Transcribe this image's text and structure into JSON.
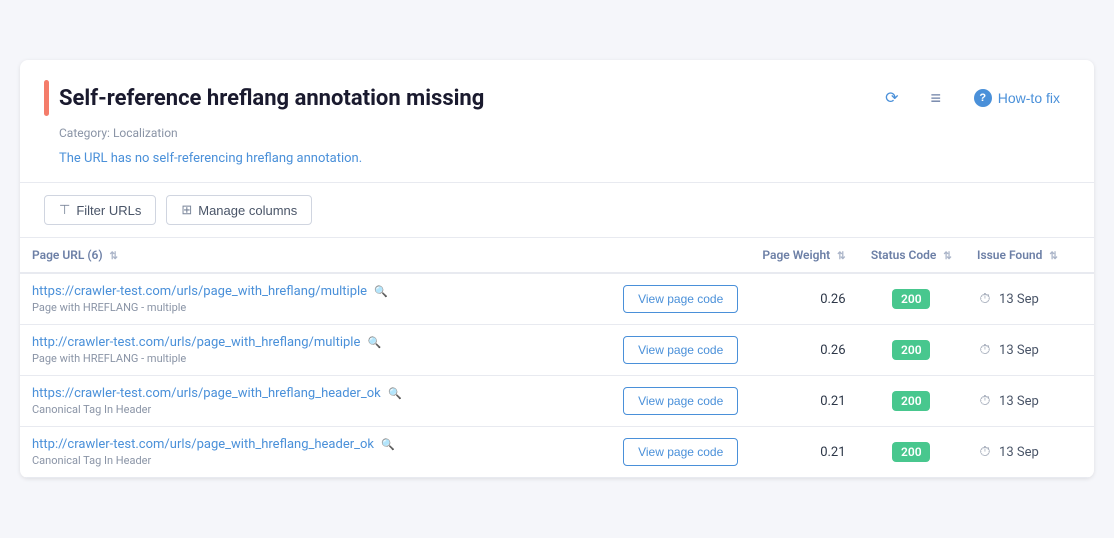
{
  "header": {
    "title": "Self-reference hreflang annotation missing",
    "category_label": "Category: Localization",
    "description": "The URL has no self-referencing hreflang annotation.",
    "how_to_fix_label": "How-to fix"
  },
  "toolbar": {
    "filter_label": "Filter URLs",
    "manage_label": "Manage columns"
  },
  "table": {
    "columns": [
      {
        "label": "Page URL (6)",
        "key": "url"
      },
      {
        "label": "",
        "key": "view"
      },
      {
        "label": "Page Weight",
        "key": "weight"
      },
      {
        "label": "Status Code",
        "key": "status"
      },
      {
        "label": "Issue Found",
        "key": "issue"
      }
    ],
    "rows": [
      {
        "url": "https://crawler-test.com/urls/page_with_hreflang/multiple",
        "subtitle": "Page with HREFLANG - multiple",
        "view_label": "View page code",
        "weight": "0.26",
        "status": "200",
        "issue": "13 Sep"
      },
      {
        "url": "http://crawler-test.com/urls/page_with_hreflang/multiple",
        "subtitle": "Page with HREFLANG - multiple",
        "view_label": "View page code",
        "weight": "0.26",
        "status": "200",
        "issue": "13 Sep"
      },
      {
        "url": "https://crawler-test.com/urls/page_with_hreflang_header_ok",
        "subtitle": "Canonical Tag In Header",
        "view_label": "View page code",
        "weight": "0.21",
        "status": "200",
        "issue": "13 Sep"
      },
      {
        "url": "http://crawler-test.com/urls/page_with_hreflang_header_ok",
        "subtitle": "Canonical Tag In Header",
        "view_label": "View page code",
        "weight": "0.21",
        "status": "200",
        "issue": "13 Sep"
      }
    ]
  },
  "icons": {
    "power": "⏻",
    "filter_table": "≡",
    "question": "?",
    "filter": "⊤",
    "manage_cols": "⊞",
    "sort": "⇅",
    "search": "🔍",
    "clock": "🕐"
  }
}
